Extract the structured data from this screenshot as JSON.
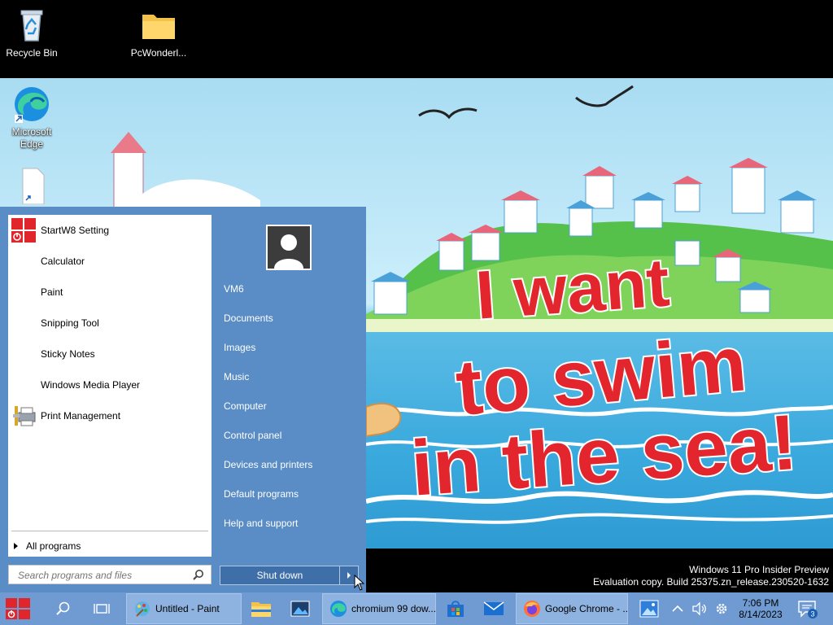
{
  "desktop": {
    "icons": [
      {
        "name": "recycle-bin",
        "label": "Recycle Bin"
      },
      {
        "name": "pcwonderland-folder",
        "label": "PcWonderl..."
      },
      {
        "name": "microsoft-edge",
        "label": "Microsoft Edge"
      },
      {
        "name": "blank-file",
        "label": ""
      }
    ]
  },
  "wallpaper": {
    "line1": "I want",
    "line2": "to swim",
    "line3": "in the sea!"
  },
  "watermark": {
    "line1": "Windows 11 Pro Insider Preview",
    "line2": "Evaluation copy. Build 25375.zn_release.230520-1632"
  },
  "start_menu": {
    "programs": [
      {
        "label": "StartW8 Setting",
        "icon": "startw8-icon"
      },
      {
        "label": "Calculator",
        "icon": ""
      },
      {
        "label": "Paint",
        "icon": ""
      },
      {
        "label": "Snipping Tool",
        "icon": ""
      },
      {
        "label": "Sticky Notes",
        "icon": ""
      },
      {
        "label": "Windows Media Player",
        "icon": ""
      },
      {
        "label": "Print Management",
        "icon": "printer-icon"
      }
    ],
    "all_programs": "All programs",
    "search_placeholder": "Search programs and files",
    "places": [
      {
        "label": "VM6"
      },
      {
        "label": "Documents"
      },
      {
        "label": "Images"
      },
      {
        "label": "Music"
      },
      {
        "label": "Computer"
      },
      {
        "label": "Control panel"
      },
      {
        "label": "Devices and printers"
      },
      {
        "label": "Default programs"
      },
      {
        "label": "Help and support"
      }
    ],
    "shutdown_label": "Shut down"
  },
  "taskbar": {
    "apps": [
      {
        "label": "Untitled - Paint",
        "icon": "paint-icon"
      },
      {
        "label": "chromium 99 dow...",
        "icon": "edge-icon"
      },
      {
        "label": "Google Chrome - ...",
        "icon": "firefox-icon"
      }
    ],
    "clock_time": "7:06 PM",
    "clock_date": "8/14/2023",
    "notification_count": "3"
  },
  "colors": {
    "start_menu_bg": "#5a8cc6",
    "taskbar_bg": "#6f9bd2",
    "accent_red": "#e0262b"
  }
}
